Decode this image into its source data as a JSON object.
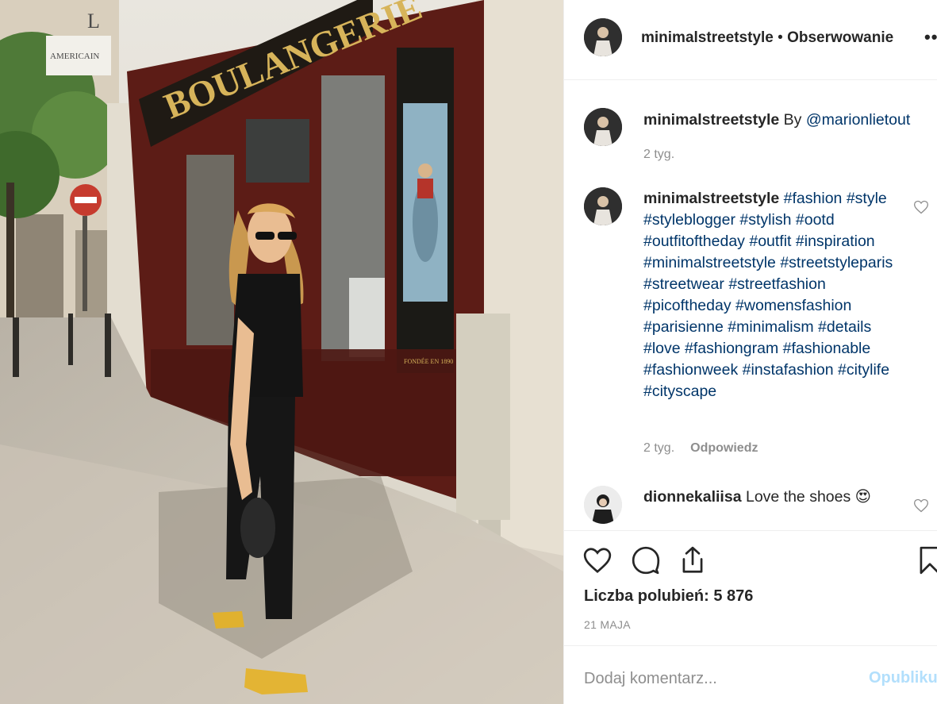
{
  "colors": {
    "link": "#003569",
    "muted": "#8e8e8e",
    "publish_disabled": "#b2dffc",
    "text": "#262626"
  },
  "photo": {
    "shop_sign": "BOULANGERIE",
    "corner_sign_letter": "L",
    "corner_sign_text": "AMERICAIN",
    "window_panel_text": "FONDÉE EN 1890"
  },
  "header": {
    "username": "minimalstreetstyle",
    "separator": " • ",
    "follow_label": "Obserwowanie",
    "more_icon": "more-horizontal-icon",
    "more_label": "••"
  },
  "caption": {
    "username": "minimalstreetstyle",
    "text": "By ",
    "mention": "@marionlietout",
    "time": "2 tyg."
  },
  "hashtag_comment": {
    "username": "minimalstreetstyle",
    "tags": [
      "#fashion",
      "#style",
      "#styleblogger",
      "#stylish",
      "#ootd",
      "#outfitoftheday",
      "#outfit",
      "#inspiration",
      "#minimalstreetstyle",
      "#streetstyleparis",
      "#streetwear",
      "#streetfashion",
      "#picoftheday",
      "#womensfashion",
      "#parisienne",
      "#minimalism",
      "#details",
      "#love",
      "#fashiongram",
      "#fashionable",
      "#fashionweek",
      "#instafashion",
      "#citylife",
      "#cityscape"
    ],
    "time": "2 tyg.",
    "reply_label": "Odpowiedz"
  },
  "reply_comment": {
    "username": "dionnekaliisa",
    "text": "Love the shoes",
    "emoji": "😍"
  },
  "actions": {
    "like_icon": "heart-icon",
    "comment_icon": "comment-bubble-icon",
    "share_icon": "share-upload-icon",
    "save_icon": "bookmark-icon",
    "likes_text": "Liczba polubień: 5 876",
    "date": "21 MAJA"
  },
  "add_comment": {
    "placeholder": "Dodaj komentarz...",
    "publish_label": "Opublikuj"
  }
}
